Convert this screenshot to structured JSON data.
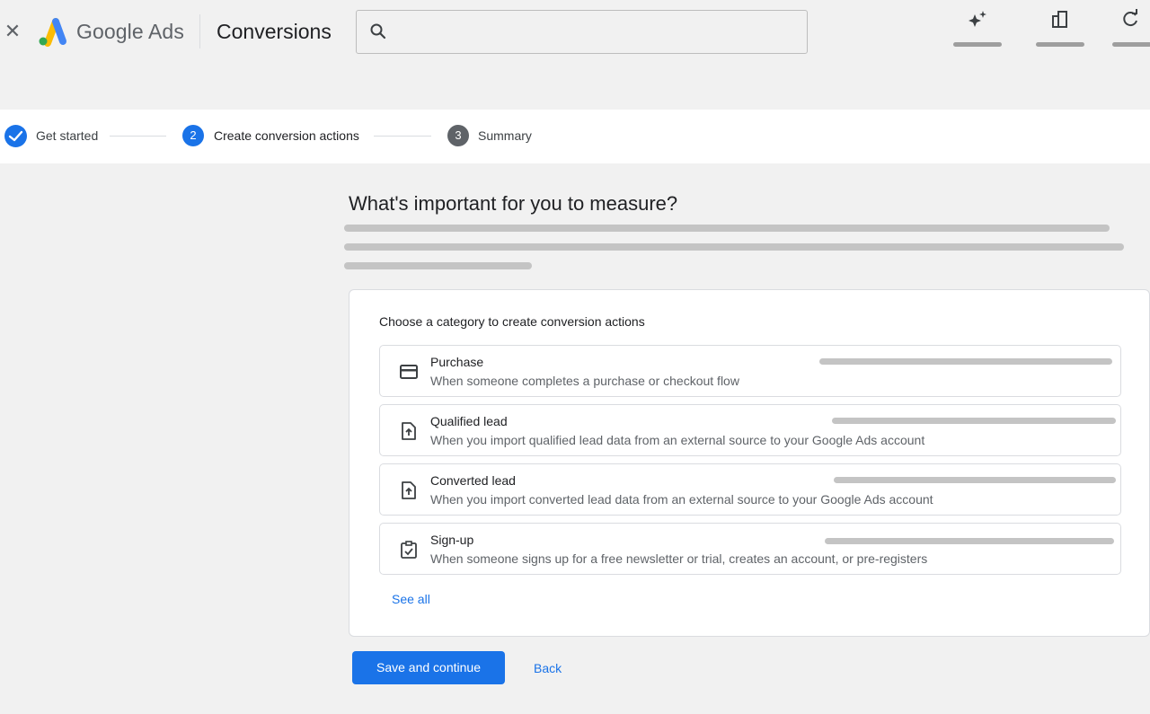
{
  "topbar": {
    "close_icon": "close-icon",
    "brand": "Google Ads",
    "page_title": "Conversions",
    "search": {
      "placeholder": "",
      "icon": "search-icon"
    },
    "tools": [
      {
        "icon": "sparkle-icon"
      },
      {
        "icon": "reports-icon"
      },
      {
        "icon": "refresh-icon"
      }
    ]
  },
  "stepper": {
    "steps": [
      {
        "label": "Get started",
        "state": "complete"
      },
      {
        "number": "2",
        "label": "Create conversion actions",
        "state": "active"
      },
      {
        "number": "3",
        "label": "Summary",
        "state": "upcoming"
      }
    ]
  },
  "main": {
    "heading": "What's important for you to measure?",
    "card": {
      "title": "Choose a category to create conversion actions",
      "options": [
        {
          "icon": "credit-card-icon",
          "title": "Purchase",
          "description": "When someone completes a purchase or checkout flow"
        },
        {
          "icon": "file-upload-icon",
          "title": "Qualified lead",
          "description": "When you import qualified lead data from an external source to your Google Ads account"
        },
        {
          "icon": "file-upload-icon",
          "title": "Converted lead",
          "description": "When you import converted lead data from an external source to your Google Ads account"
        },
        {
          "icon": "checklist-icon",
          "title": "Sign-up",
          "description": "When someone signs up for a free newsletter or trial, creates an account, or pre-registers"
        }
      ],
      "see_all": "See all"
    },
    "actions": {
      "save_label": "Save and continue",
      "back_label": "Back"
    }
  },
  "colors": {
    "accent": "#1a73e8",
    "background": "#f1f1f1",
    "step_upcoming": "#5f6368",
    "placeholder_bar": "#c4c4c4"
  }
}
